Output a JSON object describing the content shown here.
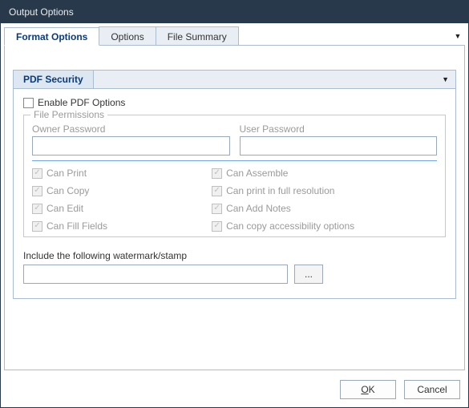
{
  "window": {
    "title": "Output Options"
  },
  "tabs": {
    "items": [
      {
        "label": "Format Options",
        "active": true
      },
      {
        "label": "Options",
        "active": false
      },
      {
        "label": "File Summary",
        "active": false
      }
    ]
  },
  "section": {
    "title": "PDF Security"
  },
  "enable": {
    "label": "Enable PDF Options",
    "checked": false
  },
  "permissions": {
    "legend": "File Permissions",
    "owner_label": "Owner Password",
    "owner_value": "",
    "user_label": "User Password",
    "user_value": "",
    "items": [
      {
        "label": "Can Print",
        "checked": true
      },
      {
        "label": "Can Assemble",
        "checked": true
      },
      {
        "label": "Can Copy",
        "checked": true
      },
      {
        "label": "Can print in full resolution",
        "checked": true
      },
      {
        "label": "Can Edit",
        "checked": true
      },
      {
        "label": "Can Add Notes",
        "checked": true
      },
      {
        "label": "Can Fill Fields",
        "checked": true
      },
      {
        "label": "Can copy accessibility options",
        "checked": true
      }
    ]
  },
  "watermark": {
    "label": "Include the following watermark/stamp",
    "value": "",
    "browse": "..."
  },
  "buttons": {
    "ok": "OK",
    "ok_accel": "O",
    "ok_rest": "K",
    "cancel": "Cancel"
  }
}
